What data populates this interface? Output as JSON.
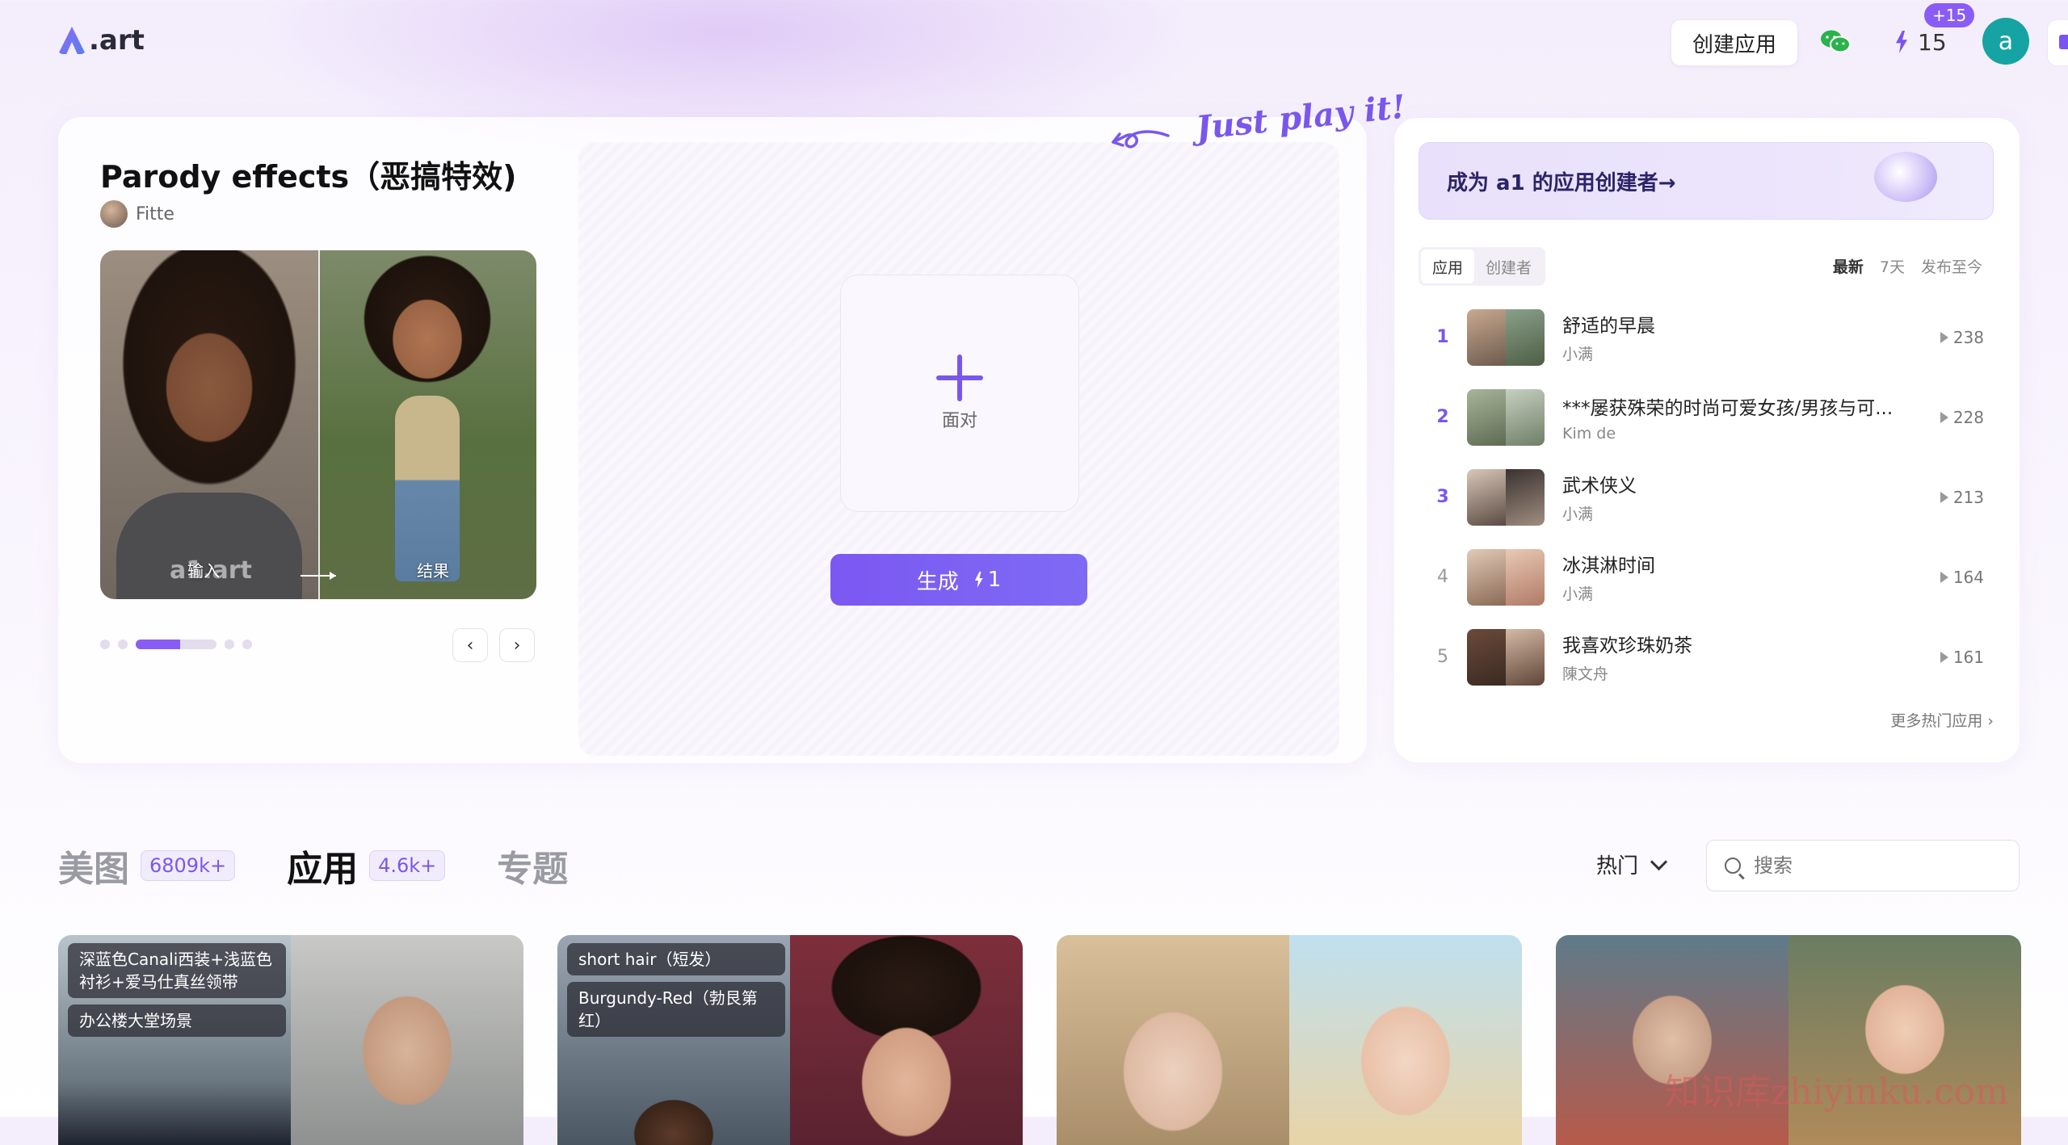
{
  "header": {
    "logo_text": ".art",
    "create_app_label": "创建应用",
    "credits_value": "15",
    "credits_bonus": "+15",
    "avatar_letter": "a"
  },
  "app": {
    "title": "Parody effects（恶搞特效)",
    "author": "Fitte",
    "preview_input_label": "输入",
    "preview_result_label": "结果",
    "preview_watermark": "a1.art",
    "upload_label": "面对",
    "generate_label": "生成",
    "generate_cost": "1",
    "tagline": "Just play it!",
    "carousel_prev": "‹",
    "carousel_next": "›"
  },
  "ranking": {
    "banner_text": "成为 a1 的应用创建者→",
    "tabs": [
      "应用",
      "创建者"
    ],
    "filters": [
      "最新",
      "7天",
      "发布至今"
    ],
    "items": [
      {
        "rank": "1",
        "title": "舒适的早晨",
        "author": "小满",
        "plays": "238"
      },
      {
        "rank": "2",
        "title": "***屡获殊荣的时尚可爱女孩/男孩与可...",
        "author": "Kim de",
        "plays": "228"
      },
      {
        "rank": "3",
        "title": "武术侠义",
        "author": "小满",
        "plays": "213"
      },
      {
        "rank": "4",
        "title": "冰淇淋时间",
        "author": "小满",
        "plays": "164"
      },
      {
        "rank": "5",
        "title": "我喜欢珍珠奶茶",
        "author": "陳文舟",
        "plays": "161"
      }
    ],
    "more_label": "更多热门应用 ›"
  },
  "section": {
    "tabs": [
      {
        "label": "美图",
        "count": "6809k+"
      },
      {
        "label": "应用",
        "count": "4.6k+"
      },
      {
        "label": "专题",
        "count": ""
      }
    ],
    "sort_label": "热门",
    "search_placeholder": "搜索"
  },
  "gallery": [
    {
      "tags": [
        "深蓝色Canali西装+浅蓝色衬衫+爱马仕真丝领带",
        "办公楼大堂场景"
      ]
    },
    {
      "tags": [
        "short hair（短发）",
        "Burgundy-Red（勃艮第红）"
      ]
    },
    {
      "tags": []
    },
    {
      "tags": []
    }
  ],
  "watermark_text": "知识库zhiyinku.com",
  "colors": {
    "accent": "#7a57ec",
    "avatar": "#16a3a3"
  }
}
